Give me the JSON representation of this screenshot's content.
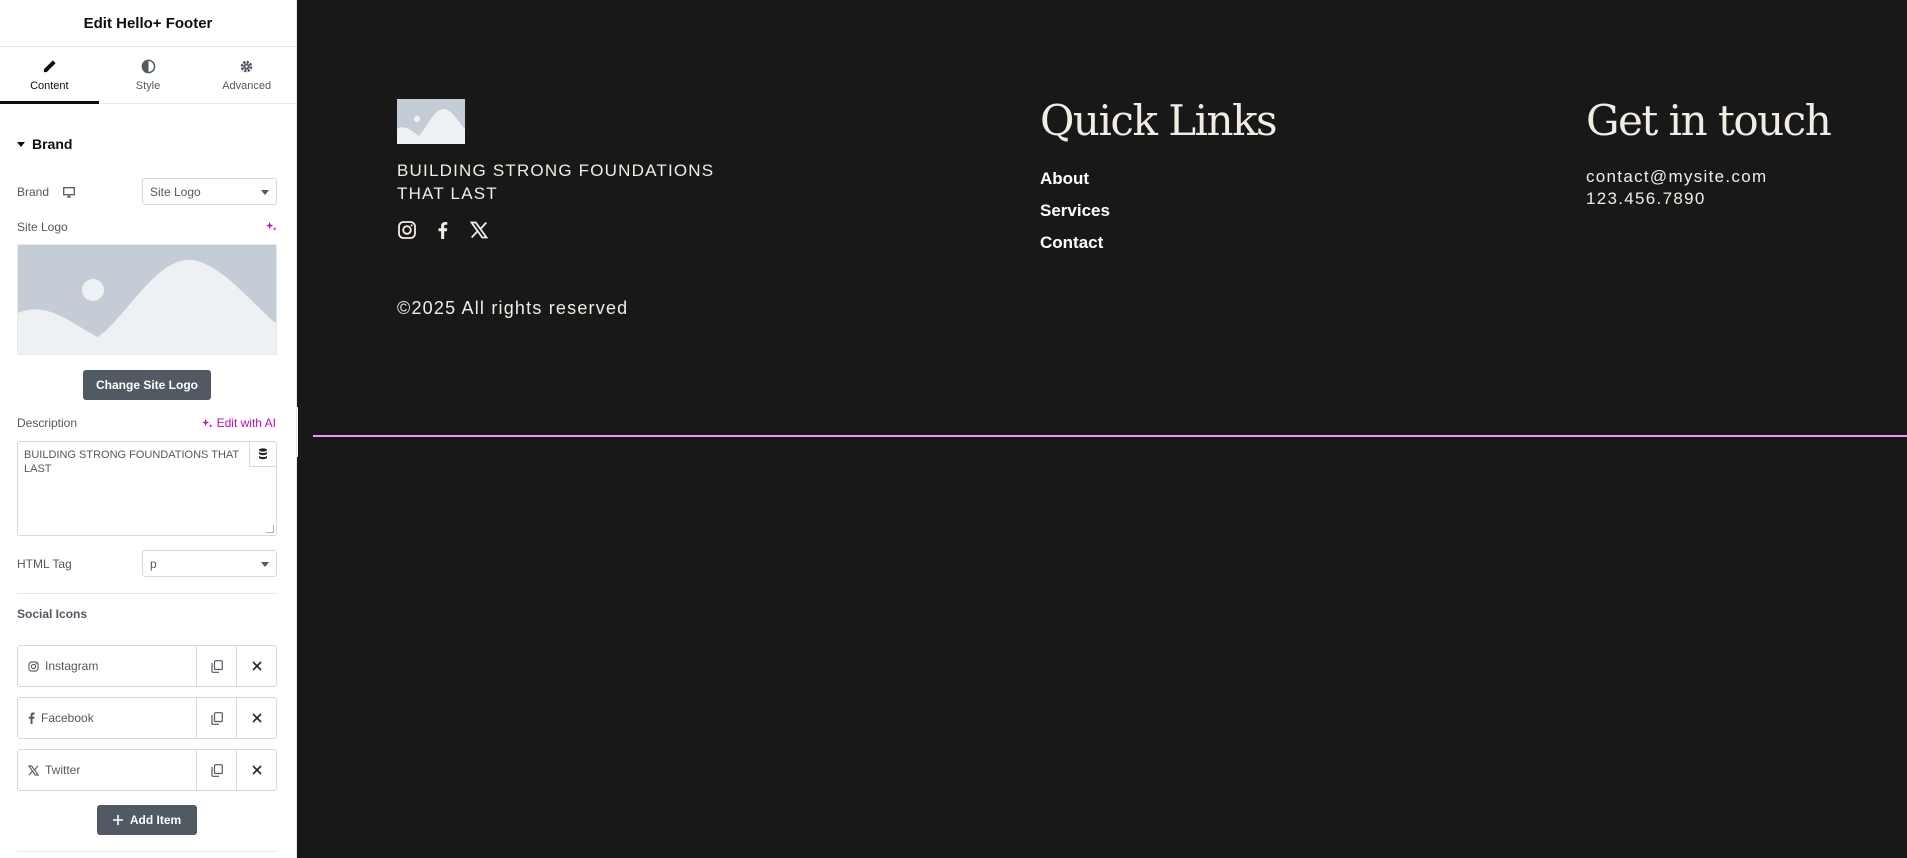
{
  "panel": {
    "title": "Edit Hello+ Footer",
    "tabs": [
      {
        "label": "Content",
        "icon": "pencil-icon",
        "active": true
      },
      {
        "label": "Style",
        "icon": "half-circle-icon",
        "active": false
      },
      {
        "label": "Advanced",
        "icon": "gear-icon",
        "active": false
      }
    ],
    "section": "Brand",
    "brand_label": "Brand",
    "brand_value": "Site Logo",
    "site_logo_label": "Site Logo",
    "change_logo_label": "Change Site Logo",
    "description_label": "Description",
    "edit_ai_label": "Edit with AI",
    "description_value": "BUILDING STRONG FOUNDATIONS THAT LAST",
    "html_tag_label": "HTML Tag",
    "html_tag_value": "p",
    "social_title": "Social Icons",
    "social_items": [
      {
        "label": "Instagram",
        "icon": "instagram-icon"
      },
      {
        "label": "Facebook",
        "icon": "facebook-icon"
      },
      {
        "label": "Twitter",
        "icon": "x-twitter-icon"
      }
    ],
    "add_item_label": "Add Item"
  },
  "footer": {
    "tagline_line1": "BUILDING STRONG FOUNDATIONS",
    "tagline_line2": "THAT LAST",
    "copyright": "©2025 All rights reserved",
    "quick_links_heading": "Quick Links",
    "links": [
      "About",
      "Services",
      "Contact"
    ],
    "contact_heading": "Get in touch",
    "email": "contact@mysite.com",
    "phone": "123.456.7890"
  },
  "colors": {
    "accent_pink": "#c00bb9",
    "guide_line": "#e99cf3",
    "canvas_bg": "#181818",
    "text_cream": "#f2ede4",
    "button_dark": "#515962"
  }
}
